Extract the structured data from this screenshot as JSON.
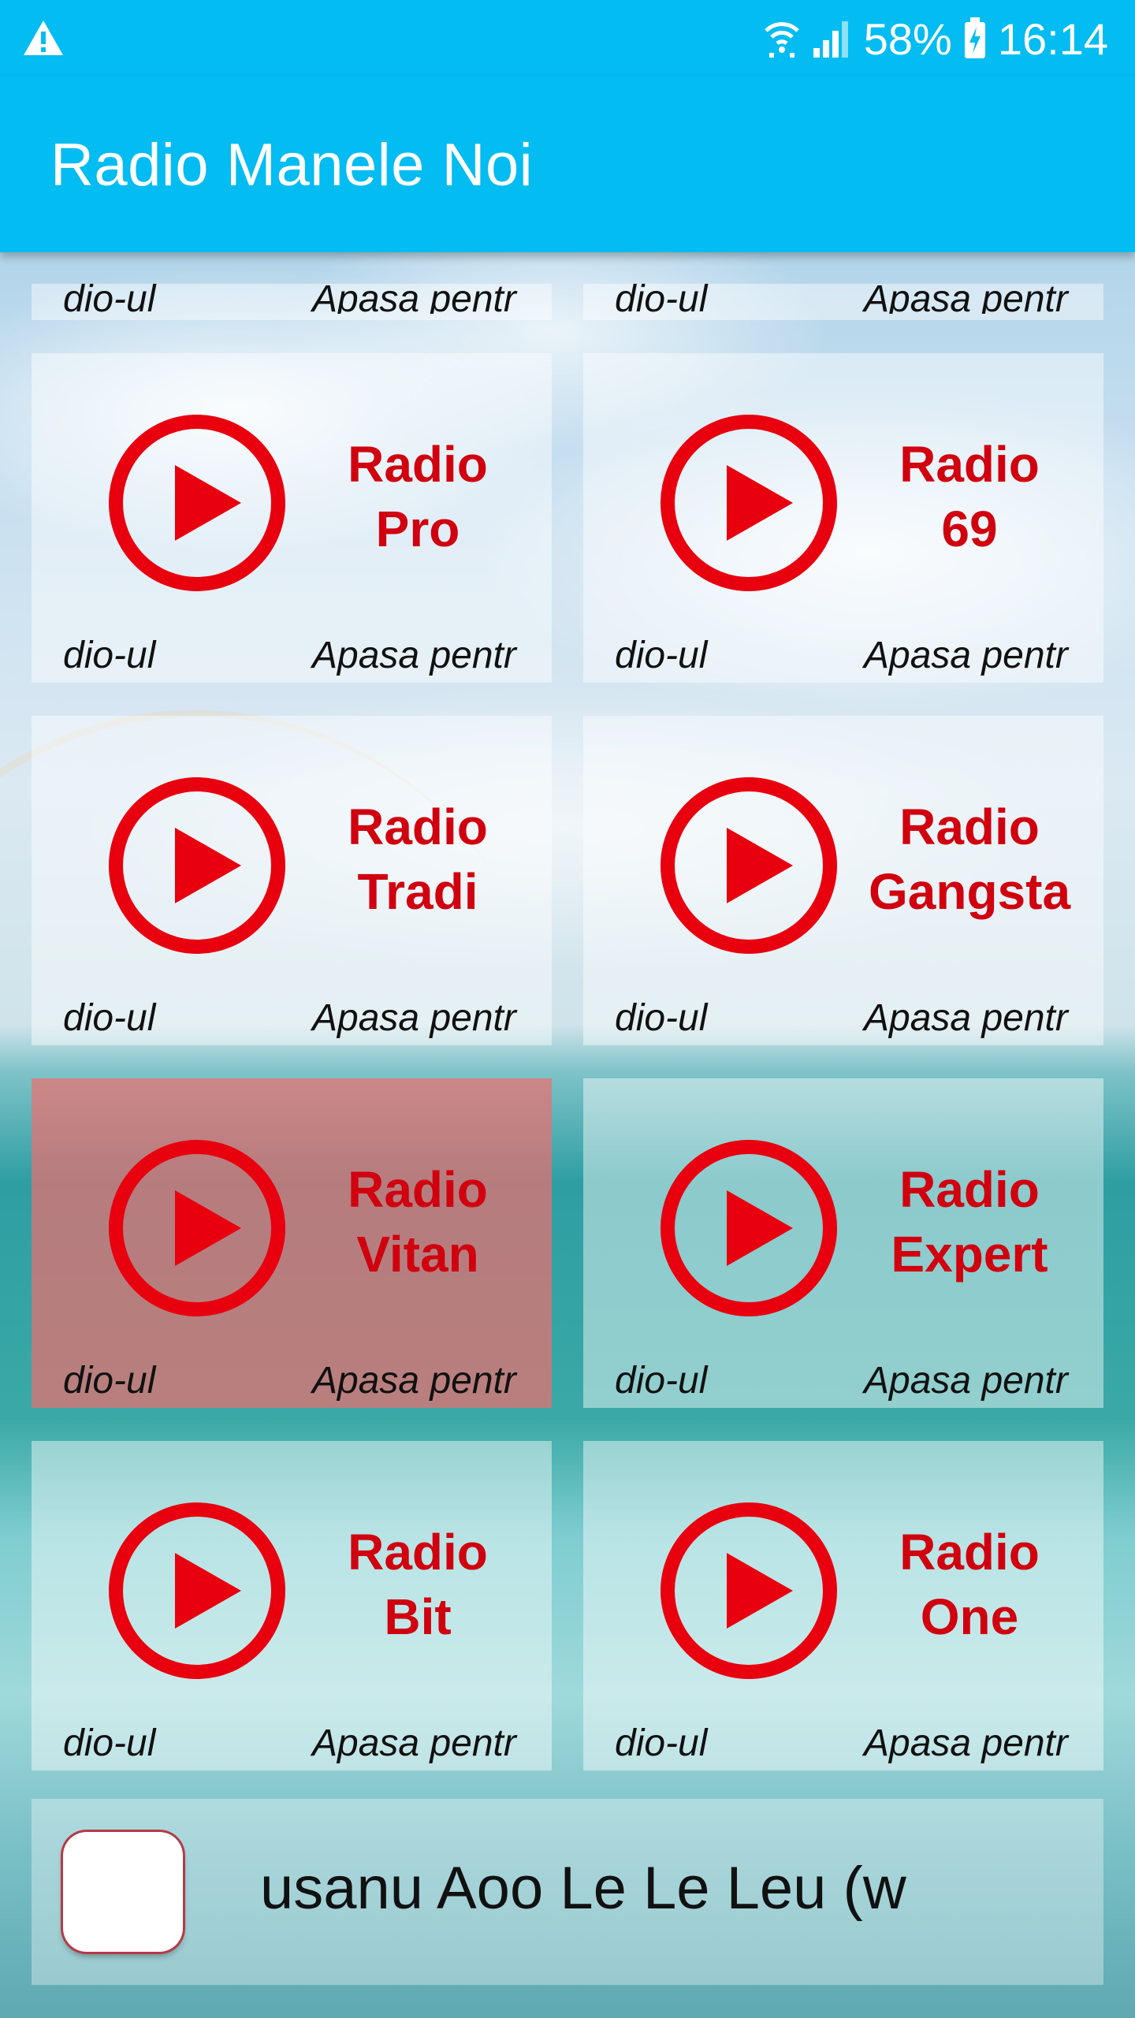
{
  "status_bar": {
    "battery": "58%",
    "time": "16:14",
    "icons": [
      "warning-icon",
      "wifi-icon",
      "signal-icon",
      "battery-charging-icon"
    ]
  },
  "app_bar": {
    "title": "Radio Manele Noi"
  },
  "cards": [
    {
      "line1": "",
      "line2": "",
      "marquee_left": "dio-ul",
      "marquee_right": "Apasa pentr"
    },
    {
      "line1": "",
      "line2": "",
      "marquee_left": "dio-ul",
      "marquee_right": "Apasa pentr"
    },
    {
      "line1": "Radio",
      "line2": "Pro",
      "marquee_left": "dio-ul",
      "marquee_right": "Apasa pentr"
    },
    {
      "line1": "Radio",
      "line2": "69",
      "marquee_left": "dio-ul",
      "marquee_right": "Apasa pentr"
    },
    {
      "line1": "Radio",
      "line2": "Tradi",
      "marquee_left": "dio-ul",
      "marquee_right": "Apasa pentr"
    },
    {
      "line1": "Radio",
      "line2": "Gangsta",
      "marquee_left": "dio-ul",
      "marquee_right": "Apasa pentr"
    },
    {
      "line1": "Radio",
      "line2": "Vitan",
      "marquee_left": "dio-ul",
      "marquee_right": "Apasa pentr"
    },
    {
      "line1": "Radio",
      "line2": "Expert",
      "marquee_left": "dio-ul",
      "marquee_right": "Apasa pentr"
    },
    {
      "line1": "Radio",
      "line2": "Bit",
      "marquee_left": "dio-ul",
      "marquee_right": "Apasa pentr"
    },
    {
      "line1": "Radio",
      "line2": "One",
      "marquee_left": "dio-ul",
      "marquee_right": "Apasa pentr"
    }
  ],
  "player": {
    "now_playing": "usanu  Aoo Le Le Leu  (w"
  },
  "colors": {
    "app_bar": "#03bcf2",
    "play_icon": "#e8000f",
    "card_title": "#d0000f",
    "selected_card": "#f06e6e"
  }
}
